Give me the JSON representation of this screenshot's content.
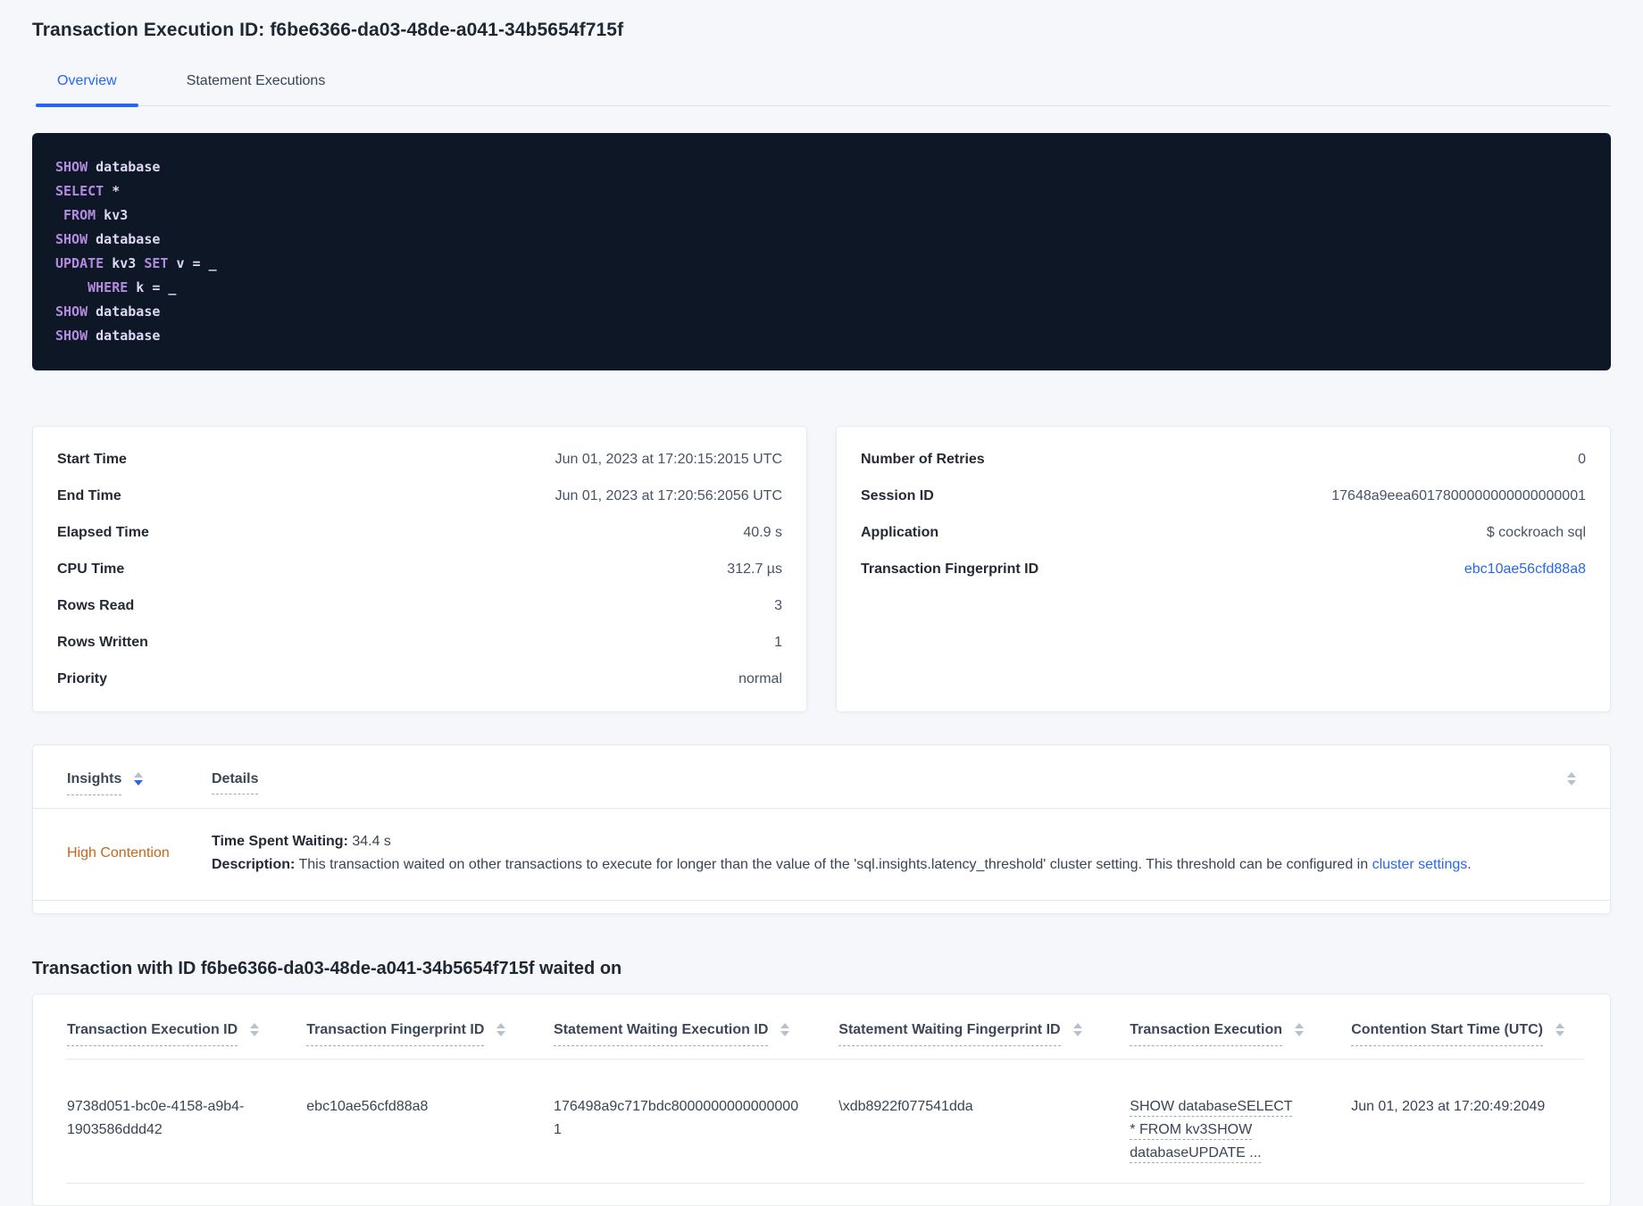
{
  "header": {
    "title": "Transaction Execution ID: f6be6366-da03-48de-a041-34b5654f715f"
  },
  "tabs": {
    "items": [
      {
        "label": "Overview",
        "active": true
      },
      {
        "label": "Statement Executions",
        "active": false
      }
    ]
  },
  "sql_box": {
    "lines": [
      [
        {
          "k": "kw",
          "v": "SHOW"
        },
        {
          "k": "pl",
          "v": " database"
        }
      ],
      [
        {
          "k": "kw",
          "v": "SELECT"
        },
        {
          "k": "pl",
          "v": " *"
        }
      ],
      [
        {
          "k": "pl",
          "v": " "
        },
        {
          "k": "kw",
          "v": "FROM"
        },
        {
          "k": "pl",
          "v": " kv3"
        }
      ],
      [
        {
          "k": "kw",
          "v": "SHOW"
        },
        {
          "k": "pl",
          "v": " database"
        }
      ],
      [
        {
          "k": "kw",
          "v": "UPDATE"
        },
        {
          "k": "pl",
          "v": " kv3 "
        },
        {
          "k": "kw",
          "v": "SET"
        },
        {
          "k": "pl",
          "v": " v = _"
        }
      ],
      [
        {
          "k": "pl",
          "v": "    "
        },
        {
          "k": "kw",
          "v": "WHERE"
        },
        {
          "k": "pl",
          "v": " k = _"
        }
      ],
      [
        {
          "k": "kw",
          "v": "SHOW"
        },
        {
          "k": "pl",
          "v": " database"
        }
      ],
      [
        {
          "k": "kw",
          "v": "SHOW"
        },
        {
          "k": "pl",
          "v": " database"
        }
      ]
    ]
  },
  "summary_left": {
    "rows": [
      {
        "label": "Start Time",
        "value": "Jun 01, 2023 at 17:20:15:2015 UTC"
      },
      {
        "label": "End Time",
        "value": "Jun 01, 2023 at 17:20:56:2056 UTC"
      },
      {
        "label": "Elapsed Time",
        "value": "40.9 s"
      },
      {
        "label": "CPU Time",
        "value": "312.7 µs"
      },
      {
        "label": "Rows Read",
        "value": "3"
      },
      {
        "label": "Rows Written",
        "value": "1"
      },
      {
        "label": "Priority",
        "value": "normal"
      }
    ]
  },
  "summary_right": {
    "rows": [
      {
        "label": "Number of Retries",
        "value": "0"
      },
      {
        "label": "Session ID",
        "value": "17648a9eea6017800000000000000001"
      },
      {
        "label": "Application",
        "value": "$ cockroach sql"
      },
      {
        "label": "Transaction Fingerprint ID",
        "value": "ebc10ae56cfd88a8",
        "link": true
      }
    ]
  },
  "insights": {
    "columns": [
      {
        "label": "Insights",
        "sortable": true,
        "sort": "desc"
      },
      {
        "label": "Details",
        "sortable": false,
        "sort": null
      }
    ],
    "row": {
      "insight": "High Contention",
      "time_spent_label": "Time Spent Waiting:",
      "time_spent_value": "34.4 s",
      "description_label": "Description:",
      "description_text": "This transaction waited on other transactions to execute for longer than the value of the 'sql.insights.latency_threshold' cluster setting. This threshold can be configured in ",
      "description_link": "cluster settings",
      "description_suffix": "."
    }
  },
  "waited_on": {
    "heading": "Transaction with ID f6be6366-da03-48de-a041-34b5654f715f waited on",
    "columns": [
      {
        "label": "Transaction Execution ID"
      },
      {
        "label": "Transaction Fingerprint ID"
      },
      {
        "label": "Statement Waiting Execution ID"
      },
      {
        "label": "Statement Waiting Fingerprint ID"
      },
      {
        "label": "Transaction Execution"
      },
      {
        "label": "Contention Start Time (UTC)"
      }
    ],
    "rows": [
      {
        "cells": [
          "9738d051-bc0e-4158-a9b4-1903586ddd42",
          "ebc10ae56cfd88a8",
          "176498a9c717bdc80000000000000001",
          "\\xdb8922f077541dda",
          "SHOW databaseSELECT * FROM kv3SHOW databaseUPDATE ...",
          "Jun 01, 2023 at 17:20:49:2049"
        ]
      }
    ]
  },
  "colors": {
    "accent_blue": "#2866f2",
    "insight_orange": "#c2671d",
    "code_bg": "#0e1726",
    "code_keyword": "#b48ae0",
    "code_text": "#ded8f4",
    "page_bg": "#f5f7fa",
    "card_border": "#e6ebf2"
  }
}
